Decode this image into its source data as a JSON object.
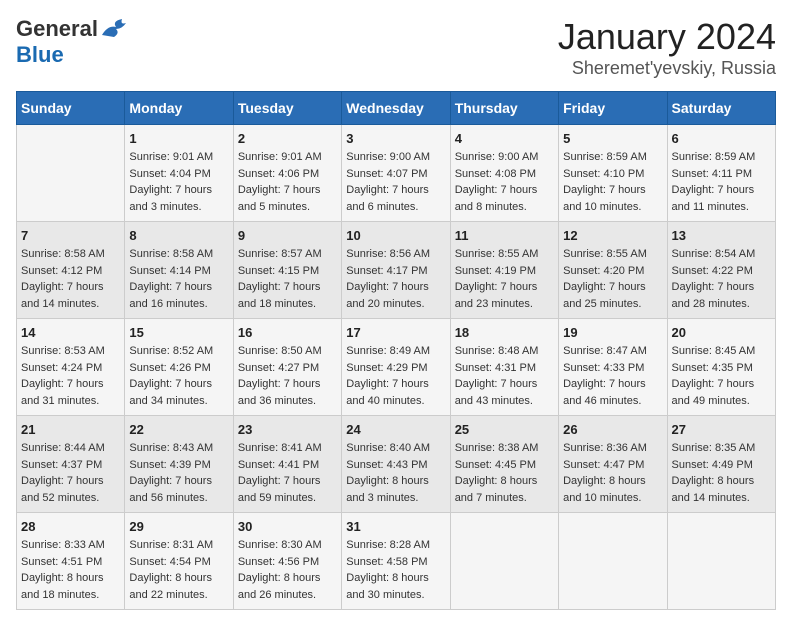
{
  "logo": {
    "general": "General",
    "blue": "Blue"
  },
  "title": "January 2024",
  "subtitle": "Sheremet'yevskiy, Russia",
  "days_of_week": [
    "Sunday",
    "Monday",
    "Tuesday",
    "Wednesday",
    "Thursday",
    "Friday",
    "Saturday"
  ],
  "weeks": [
    [
      {
        "day": "",
        "info": ""
      },
      {
        "day": "1",
        "info": "Sunrise: 9:01 AM\nSunset: 4:04 PM\nDaylight: 7 hours\nand 3 minutes."
      },
      {
        "day": "2",
        "info": "Sunrise: 9:01 AM\nSunset: 4:06 PM\nDaylight: 7 hours\nand 5 minutes."
      },
      {
        "day": "3",
        "info": "Sunrise: 9:00 AM\nSunset: 4:07 PM\nDaylight: 7 hours\nand 6 minutes."
      },
      {
        "day": "4",
        "info": "Sunrise: 9:00 AM\nSunset: 4:08 PM\nDaylight: 7 hours\nand 8 minutes."
      },
      {
        "day": "5",
        "info": "Sunrise: 8:59 AM\nSunset: 4:10 PM\nDaylight: 7 hours\nand 10 minutes."
      },
      {
        "day": "6",
        "info": "Sunrise: 8:59 AM\nSunset: 4:11 PM\nDaylight: 7 hours\nand 11 minutes."
      }
    ],
    [
      {
        "day": "7",
        "info": "Sunrise: 8:58 AM\nSunset: 4:12 PM\nDaylight: 7 hours\nand 14 minutes."
      },
      {
        "day": "8",
        "info": "Sunrise: 8:58 AM\nSunset: 4:14 PM\nDaylight: 7 hours\nand 16 minutes."
      },
      {
        "day": "9",
        "info": "Sunrise: 8:57 AM\nSunset: 4:15 PM\nDaylight: 7 hours\nand 18 minutes."
      },
      {
        "day": "10",
        "info": "Sunrise: 8:56 AM\nSunset: 4:17 PM\nDaylight: 7 hours\nand 20 minutes."
      },
      {
        "day": "11",
        "info": "Sunrise: 8:55 AM\nSunset: 4:19 PM\nDaylight: 7 hours\nand 23 minutes."
      },
      {
        "day": "12",
        "info": "Sunrise: 8:55 AM\nSunset: 4:20 PM\nDaylight: 7 hours\nand 25 minutes."
      },
      {
        "day": "13",
        "info": "Sunrise: 8:54 AM\nSunset: 4:22 PM\nDaylight: 7 hours\nand 28 minutes."
      }
    ],
    [
      {
        "day": "14",
        "info": "Sunrise: 8:53 AM\nSunset: 4:24 PM\nDaylight: 7 hours\nand 31 minutes."
      },
      {
        "day": "15",
        "info": "Sunrise: 8:52 AM\nSunset: 4:26 PM\nDaylight: 7 hours\nand 34 minutes."
      },
      {
        "day": "16",
        "info": "Sunrise: 8:50 AM\nSunset: 4:27 PM\nDaylight: 7 hours\nand 36 minutes."
      },
      {
        "day": "17",
        "info": "Sunrise: 8:49 AM\nSunset: 4:29 PM\nDaylight: 7 hours\nand 40 minutes."
      },
      {
        "day": "18",
        "info": "Sunrise: 8:48 AM\nSunset: 4:31 PM\nDaylight: 7 hours\nand 43 minutes."
      },
      {
        "day": "19",
        "info": "Sunrise: 8:47 AM\nSunset: 4:33 PM\nDaylight: 7 hours\nand 46 minutes."
      },
      {
        "day": "20",
        "info": "Sunrise: 8:45 AM\nSunset: 4:35 PM\nDaylight: 7 hours\nand 49 minutes."
      }
    ],
    [
      {
        "day": "21",
        "info": "Sunrise: 8:44 AM\nSunset: 4:37 PM\nDaylight: 7 hours\nand 52 minutes."
      },
      {
        "day": "22",
        "info": "Sunrise: 8:43 AM\nSunset: 4:39 PM\nDaylight: 7 hours\nand 56 minutes."
      },
      {
        "day": "23",
        "info": "Sunrise: 8:41 AM\nSunset: 4:41 PM\nDaylight: 7 hours\nand 59 minutes."
      },
      {
        "day": "24",
        "info": "Sunrise: 8:40 AM\nSunset: 4:43 PM\nDaylight: 8 hours\nand 3 minutes."
      },
      {
        "day": "25",
        "info": "Sunrise: 8:38 AM\nSunset: 4:45 PM\nDaylight: 8 hours\nand 7 minutes."
      },
      {
        "day": "26",
        "info": "Sunrise: 8:36 AM\nSunset: 4:47 PM\nDaylight: 8 hours\nand 10 minutes."
      },
      {
        "day": "27",
        "info": "Sunrise: 8:35 AM\nSunset: 4:49 PM\nDaylight: 8 hours\nand 14 minutes."
      }
    ],
    [
      {
        "day": "28",
        "info": "Sunrise: 8:33 AM\nSunset: 4:51 PM\nDaylight: 8 hours\nand 18 minutes."
      },
      {
        "day": "29",
        "info": "Sunrise: 8:31 AM\nSunset: 4:54 PM\nDaylight: 8 hours\nand 22 minutes."
      },
      {
        "day": "30",
        "info": "Sunrise: 8:30 AM\nSunset: 4:56 PM\nDaylight: 8 hours\nand 26 minutes."
      },
      {
        "day": "31",
        "info": "Sunrise: 8:28 AM\nSunset: 4:58 PM\nDaylight: 8 hours\nand 30 minutes."
      },
      {
        "day": "",
        "info": ""
      },
      {
        "day": "",
        "info": ""
      },
      {
        "day": "",
        "info": ""
      }
    ]
  ]
}
